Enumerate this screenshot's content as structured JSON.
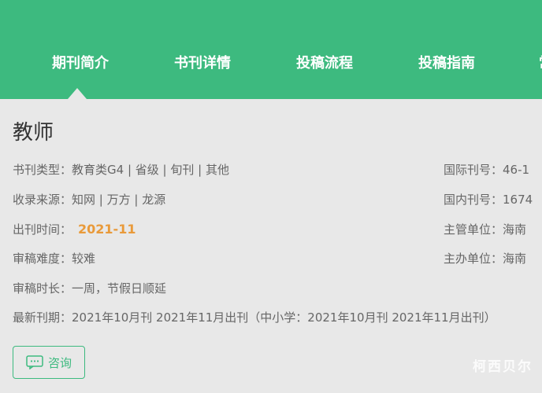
{
  "nav": {
    "items": [
      {
        "label": "期刊简介"
      },
      {
        "label": "书刊详情"
      },
      {
        "label": "投稿流程"
      },
      {
        "label": "投稿指南"
      },
      {
        "label": "常"
      }
    ]
  },
  "journal": {
    "title": "教师",
    "type_label": "书刊类型：",
    "type_value": "教育类G4 | 省级 | 旬刊 | 其他",
    "source_label": "收录来源：",
    "source_value": "知网 | 万方 | 龙源",
    "pubtime_label": "出刊时间：",
    "pubtime_value": "2021-11",
    "difficulty_label": "审稿难度：",
    "difficulty_value": "较难",
    "duration_label": "审稿时长：",
    "duration_value": "一周，节假日顺延",
    "latest_label": "最新刊期：",
    "latest_value": "2021年10月刊 2021年11月出刊（中小学：2021年10月刊 2021年11月出刊）",
    "issn_label": "国际刊号：",
    "issn_value": "46-1",
    "cn_label": "国内刊号：",
    "cn_value": "1674",
    "supervisor_label": "主管单位：",
    "supervisor_value": "海南",
    "sponsor_label": "主办单位：",
    "sponsor_value": "海南"
  },
  "consult_button": {
    "label": "咨询"
  },
  "watermark": "柯西贝尔",
  "colors": {
    "brand": "#3dba7f",
    "accent": "#e99a3a"
  }
}
